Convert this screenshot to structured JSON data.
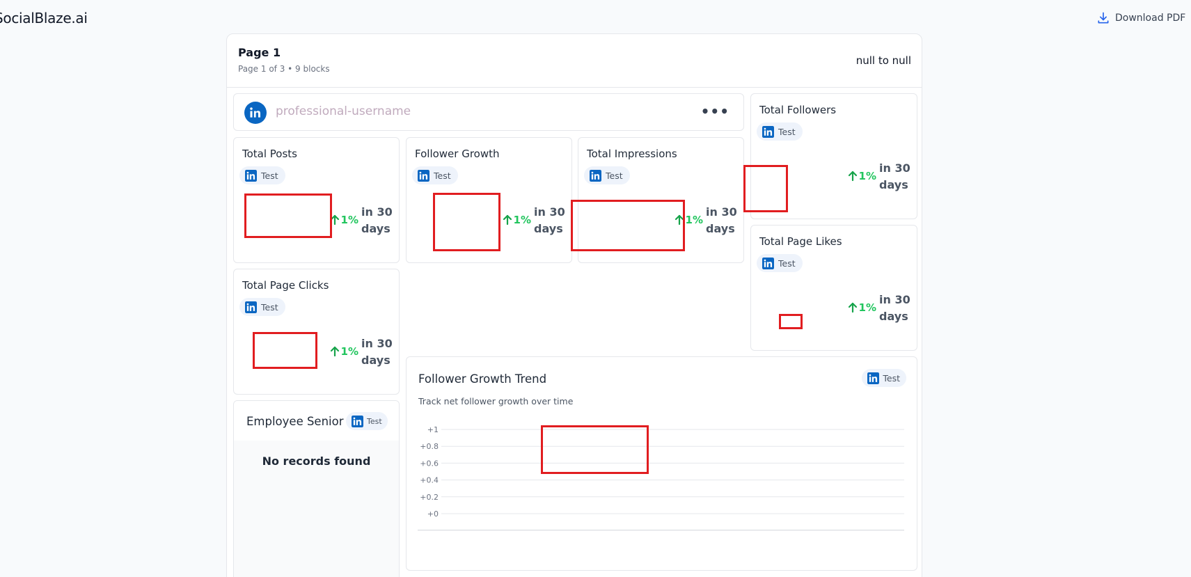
{
  "header": {
    "brand": "SocialBlaze.ai",
    "download_label": "Download PDF"
  },
  "page": {
    "title": "Page 1",
    "subtitle": "Page 1 of 3 • 9 blocks",
    "date_range": "null to null"
  },
  "profile": {
    "username": "professional-username",
    "network_icon": "linkedin-icon",
    "menu_icon": "ellipsis-icon"
  },
  "stats": [
    {
      "title": "Total Posts",
      "tag": "Test",
      "change": "1%",
      "period": "in 30 days"
    },
    {
      "title": "Follower Growth",
      "tag": "Test",
      "change": "1%",
      "period": "in 30 days"
    },
    {
      "title": "Total Impressions",
      "tag": "Test",
      "change": "1%",
      "period": "in 30 days"
    },
    {
      "title": "Total Followers",
      "tag": "Test",
      "change": "1%",
      "period": "in 30 days"
    },
    {
      "title": "Total Page Clicks",
      "tag": "Test",
      "change": "1%",
      "period": "in 30 days"
    },
    {
      "title": "Total Page Likes",
      "tag": "Test",
      "change": "1%",
      "period": "in 30 days"
    }
  ],
  "employee": {
    "title": "Employee Senior",
    "tag": "Test",
    "empty_text": "No records found"
  },
  "trend": {
    "title": "Follower Growth Trend",
    "subtitle": "Track net follower growth over time",
    "tag": "Test"
  },
  "chart_data": {
    "type": "line",
    "title": "Follower Growth Trend",
    "subtitle": "Track net follower growth over time",
    "y_ticks": [
      "+1",
      "+0.8",
      "+0.6",
      "+0.4",
      "+0.2",
      "+0"
    ],
    "ylim": [
      0,
      1
    ],
    "grid": true,
    "series": []
  },
  "colors": {
    "accent_green": "#22c55e",
    "linkedin_blue": "#0a66c2",
    "highlight_red": "#e11d20"
  }
}
